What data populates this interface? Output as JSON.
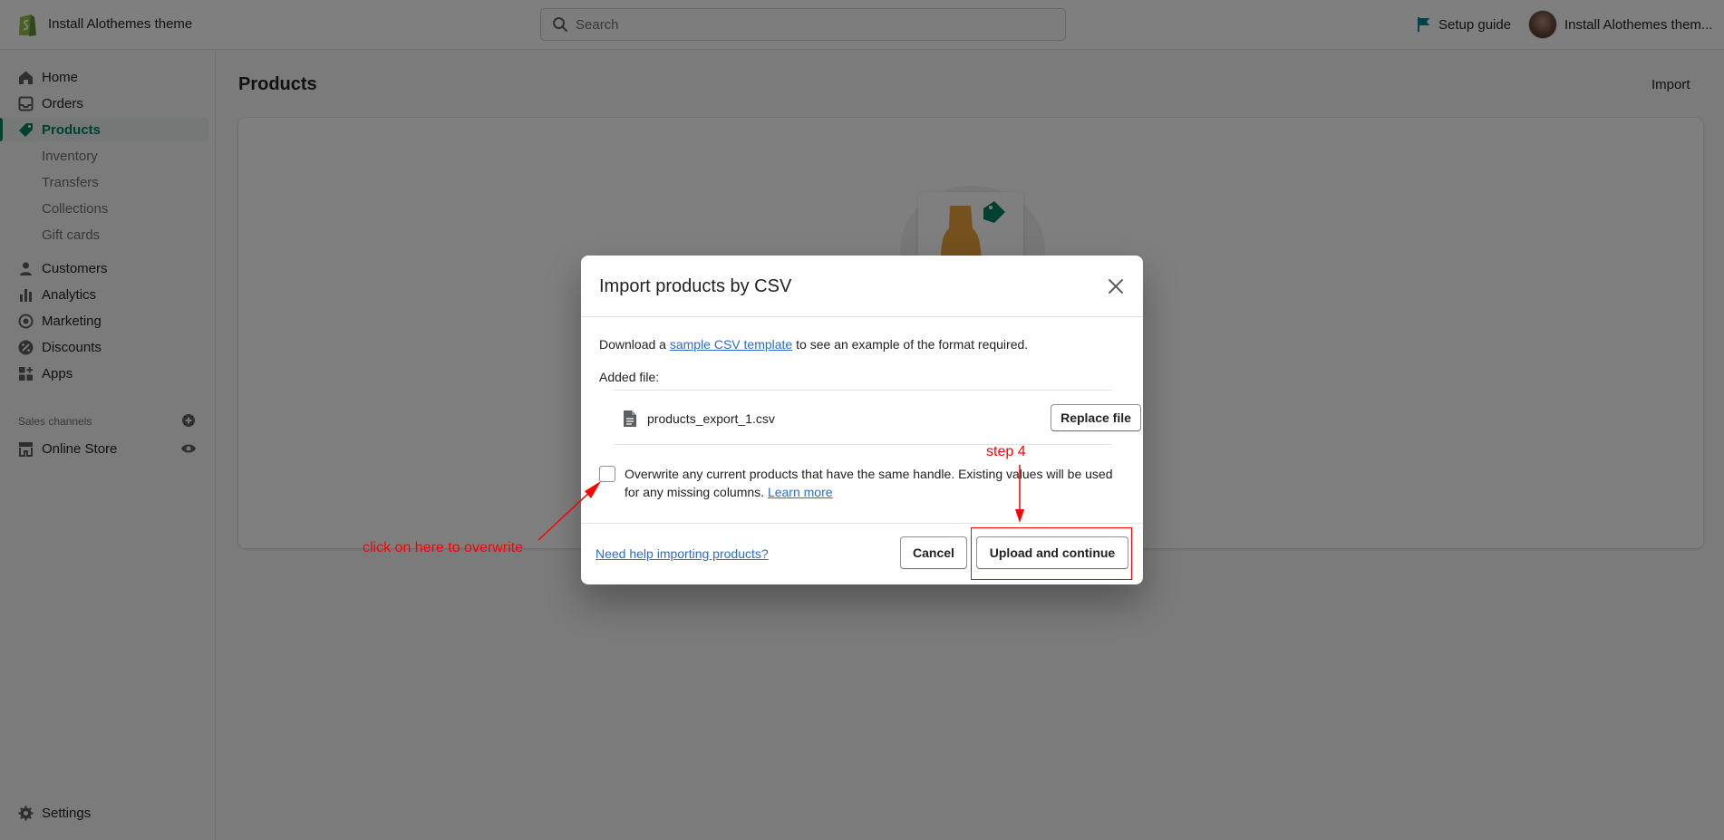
{
  "app": {
    "store_name": "Install Alothemes theme",
    "search_placeholder": "Search",
    "setup_guide": "Setup guide",
    "account_name": "Install Alothemes them..."
  },
  "sidebar": {
    "items": [
      {
        "label": "Home",
        "icon": "home-icon"
      },
      {
        "label": "Orders",
        "icon": "orders-icon"
      },
      {
        "label": "Products",
        "icon": "tag-icon",
        "active": true
      },
      {
        "label": "Customers",
        "icon": "person-icon"
      },
      {
        "label": "Analytics",
        "icon": "bar-chart-icon"
      },
      {
        "label": "Marketing",
        "icon": "target-icon"
      },
      {
        "label": "Discounts",
        "icon": "discount-icon"
      },
      {
        "label": "Apps",
        "icon": "apps-icon"
      }
    ],
    "product_subitems": [
      "Inventory",
      "Transfers",
      "Collections",
      "Gift cards"
    ],
    "sales_channels_label": "Sales channels",
    "online_store": "Online Store",
    "settings": "Settings"
  },
  "main": {
    "title": "Products",
    "import_label": "Import"
  },
  "modal": {
    "title": "Import products by CSV",
    "desc_prefix": "Download a ",
    "desc_link": "sample CSV template",
    "desc_suffix": " to see an example of the format required.",
    "added_file_label": "Added file:",
    "file_name": "products_export_1.csv",
    "replace_button": "Replace file",
    "overwrite_text": "Overwrite any current products that have the same handle. Existing values will be used for any missing columns.",
    "learn_more": "Learn more",
    "help_link": "Need help importing products?",
    "cancel_button": "Cancel",
    "upload_button": "Upload and continue"
  },
  "annotations": {
    "step_label": "step 4",
    "overwrite_hint": "click on here to overwrite",
    "color": "#ff0000"
  },
  "colors": {
    "brand_green": "#008060",
    "link_blue": "#2c6ecb"
  }
}
